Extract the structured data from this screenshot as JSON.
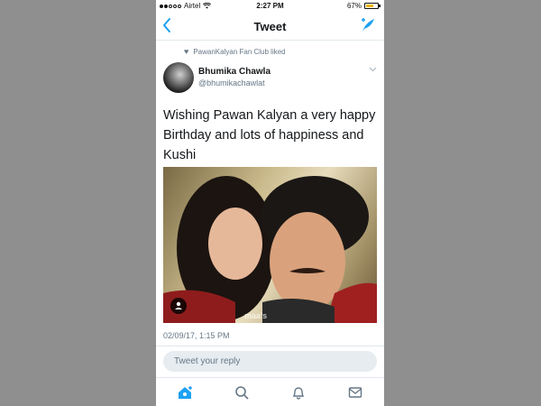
{
  "status_bar": {
    "carrier": "Airtel",
    "time": "2:27 PM",
    "battery_text": "67%",
    "battery_level": 0.67
  },
  "header": {
    "title": "Tweet",
    "back_icon": "chevron-left-icon",
    "compose_icon": "compose-tweet-icon"
  },
  "social_context": {
    "text": "PawanKalyan Fan Club liked",
    "icon": "heart-icon"
  },
  "tweet": {
    "author_name": "Bhumika  Chawla",
    "author_handle": "@bhumikachawlat",
    "text": "Wishing Pawan Kalyan a very happy Birthday and lots of happiness and Kushi",
    "image_watermark": "maa's",
    "timestamp": "02/09/17, 1:15 PM"
  },
  "reply": {
    "placeholder": "Tweet your reply"
  },
  "tabbar": {
    "items": [
      "home-icon",
      "search-icon",
      "notifications-icon",
      "messages-icon"
    ]
  },
  "colors": {
    "accent": "#1da1f2",
    "text": "#14171a",
    "secondary": "#657786",
    "background": "#8f8f8f"
  }
}
